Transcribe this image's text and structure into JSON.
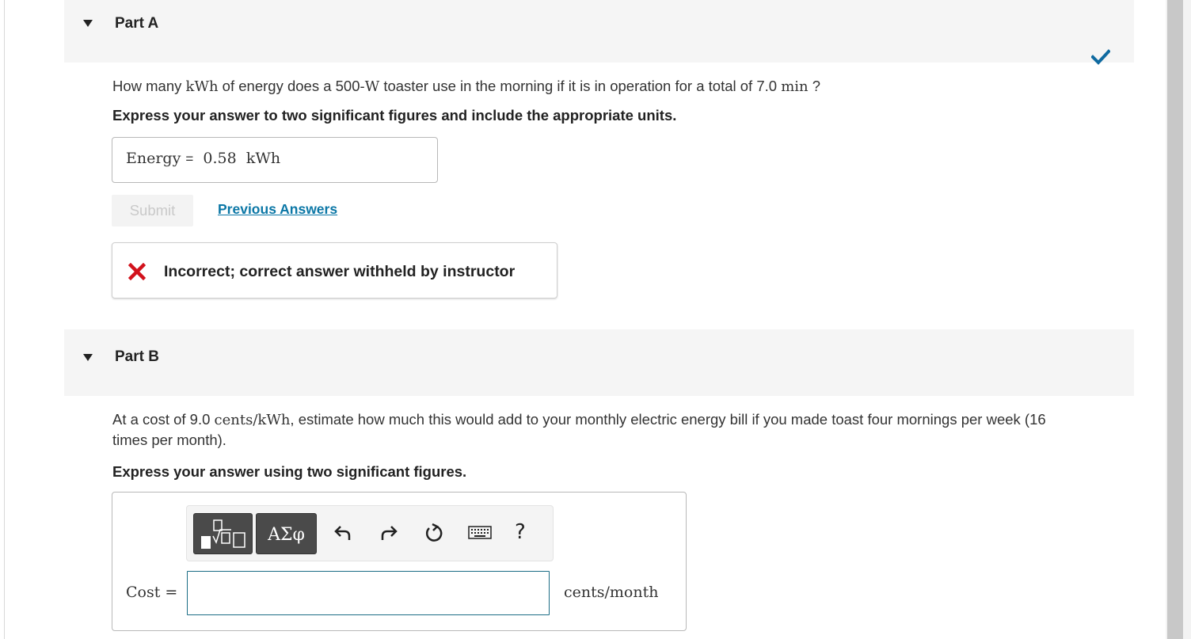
{
  "colors": {
    "accent": "#0b77a6",
    "correct": "#0f6aa0",
    "incorrect": "#d2121c",
    "header_bg": "#f5f5f5"
  },
  "part_a": {
    "title": "Part A",
    "status_icon": "check-icon",
    "question": {
      "pre": "How many ",
      "unit1": "kWh",
      "mid": " of energy does a 500-",
      "unit2": "W",
      "post": " toaster use in the morning if it is in operation for a total of 7.0 ",
      "unit3": "min",
      "end": " ?"
    },
    "instruction": "Express your answer to two significant figures and include the appropriate units.",
    "answer": {
      "label": "Energy",
      "equals": "=",
      "value": "0.58",
      "unit": "kWh"
    },
    "submit_label": "Submit",
    "previous_answers_label": "Previous Answers",
    "feedback": {
      "icon": "x-icon",
      "message": "Incorrect; correct answer withheld by instructor"
    }
  },
  "part_b": {
    "title": "Part B",
    "question": {
      "pre": "At a cost of 9.0 ",
      "unit": "cents/kWh",
      "post": ", estimate how much this would add to your monthly electric energy bill if you made toast four mornings per week (16",
      "line2": "times per month)."
    },
    "instruction": "Express your answer using two significant figures.",
    "toolbar": {
      "templates_icon": "templates-icon",
      "symbols_label": "ΑΣφ",
      "undo_icon": "undo-icon",
      "redo_icon": "redo-icon",
      "reset_icon": "reset-icon",
      "keyboard_icon": "keyboard-icon",
      "help_label": "?"
    },
    "answer": {
      "label": "Cost =",
      "value": "",
      "units": "cents/month"
    }
  }
}
